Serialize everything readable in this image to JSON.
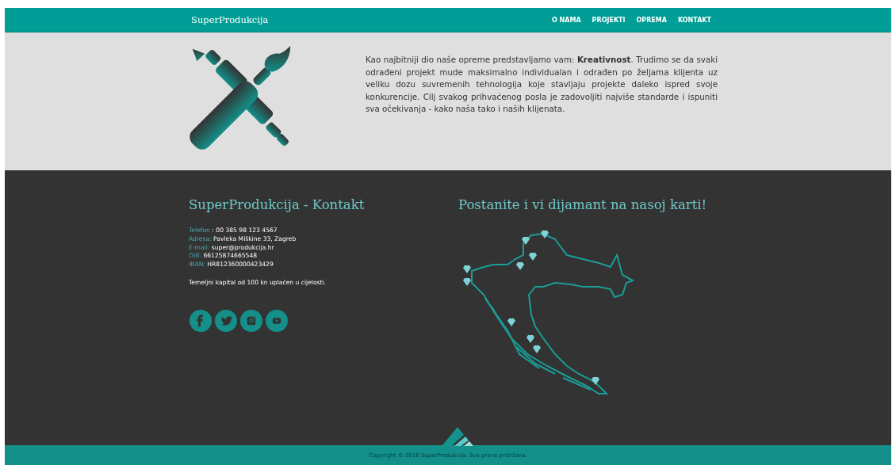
{
  "navbar": {
    "brand": "SuperProdukcija",
    "links": [
      {
        "label": "O NAMA"
      },
      {
        "label": "PROJEKTI"
      },
      {
        "label": "OPREMA"
      },
      {
        "label": "KONTAKT"
      }
    ]
  },
  "hero": {
    "text": "Kao najbitniji dio naše opreme predstavljamo vam: **Kreativnost**. Trudimo se da svaki odrađeni projekt mude maksimalno individualan i odrađen po željama klijenta uz veliku dozu suvremenih tehnologija koje stavljaju projekte daleko ispred svoje konkurencije. Cilj svakog prihvaćenog posla je zadovoljiti najviše standarde i ispuniti sva očekivanja - kako naša tako i naših klijenata."
  },
  "contact": {
    "heading": "SuperProdukcija - Kontakt",
    "lines": [
      {
        "label": "Telefon",
        "value": ": 00 385 98 123 4567"
      },
      {
        "label": "Adresa:",
        "value": "Pavleka Miškine 33, Zagreb"
      },
      {
        "label": "E-mail:",
        "value": "super@produkcija.hr"
      },
      {
        "label": "OIB:",
        "value": "66125874665548"
      },
      {
        "label": "IBAN:",
        "value": "HR812360000423429"
      }
    ],
    "note": "Temeljni kapital od 100 kn uplaćen u cijelosti.",
    "social": [
      {
        "kind": "facebook"
      },
      {
        "kind": "twitter"
      },
      {
        "kind": "instagram"
      },
      {
        "kind": "youtube"
      }
    ]
  },
  "map": {
    "heading": "Postanite i vi dijamant na nasoj karti!"
  },
  "footer": {
    "copyright": "Copyright © 2016 SuperProdukcija. Sva prava pridržana."
  }
}
